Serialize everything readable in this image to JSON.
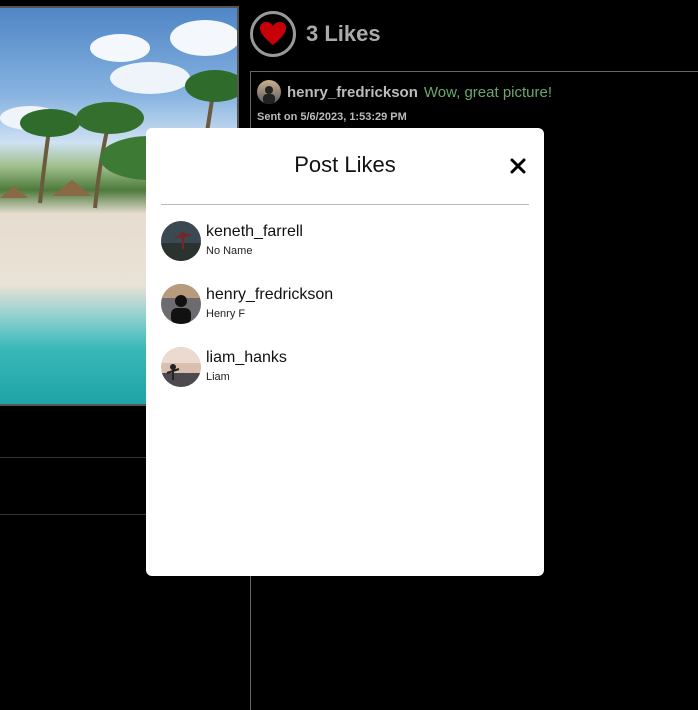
{
  "post": {
    "likes_label": "3 Likes",
    "heart_color": "#c8000a"
  },
  "comments": [
    {
      "username": "henry_fredrickson",
      "text": "Wow, great picture!",
      "sent": "Sent on 5/6/2023, 1:53:29 PM"
    }
  ],
  "modal": {
    "title": "Post Likes",
    "close_symbol": "×",
    "likes": [
      {
        "username": "keneth_farrell",
        "name": "No Name"
      },
      {
        "username": "henry_fredrickson",
        "name": "Henry F"
      },
      {
        "username": "liam_hanks",
        "name": "Liam"
      }
    ]
  }
}
